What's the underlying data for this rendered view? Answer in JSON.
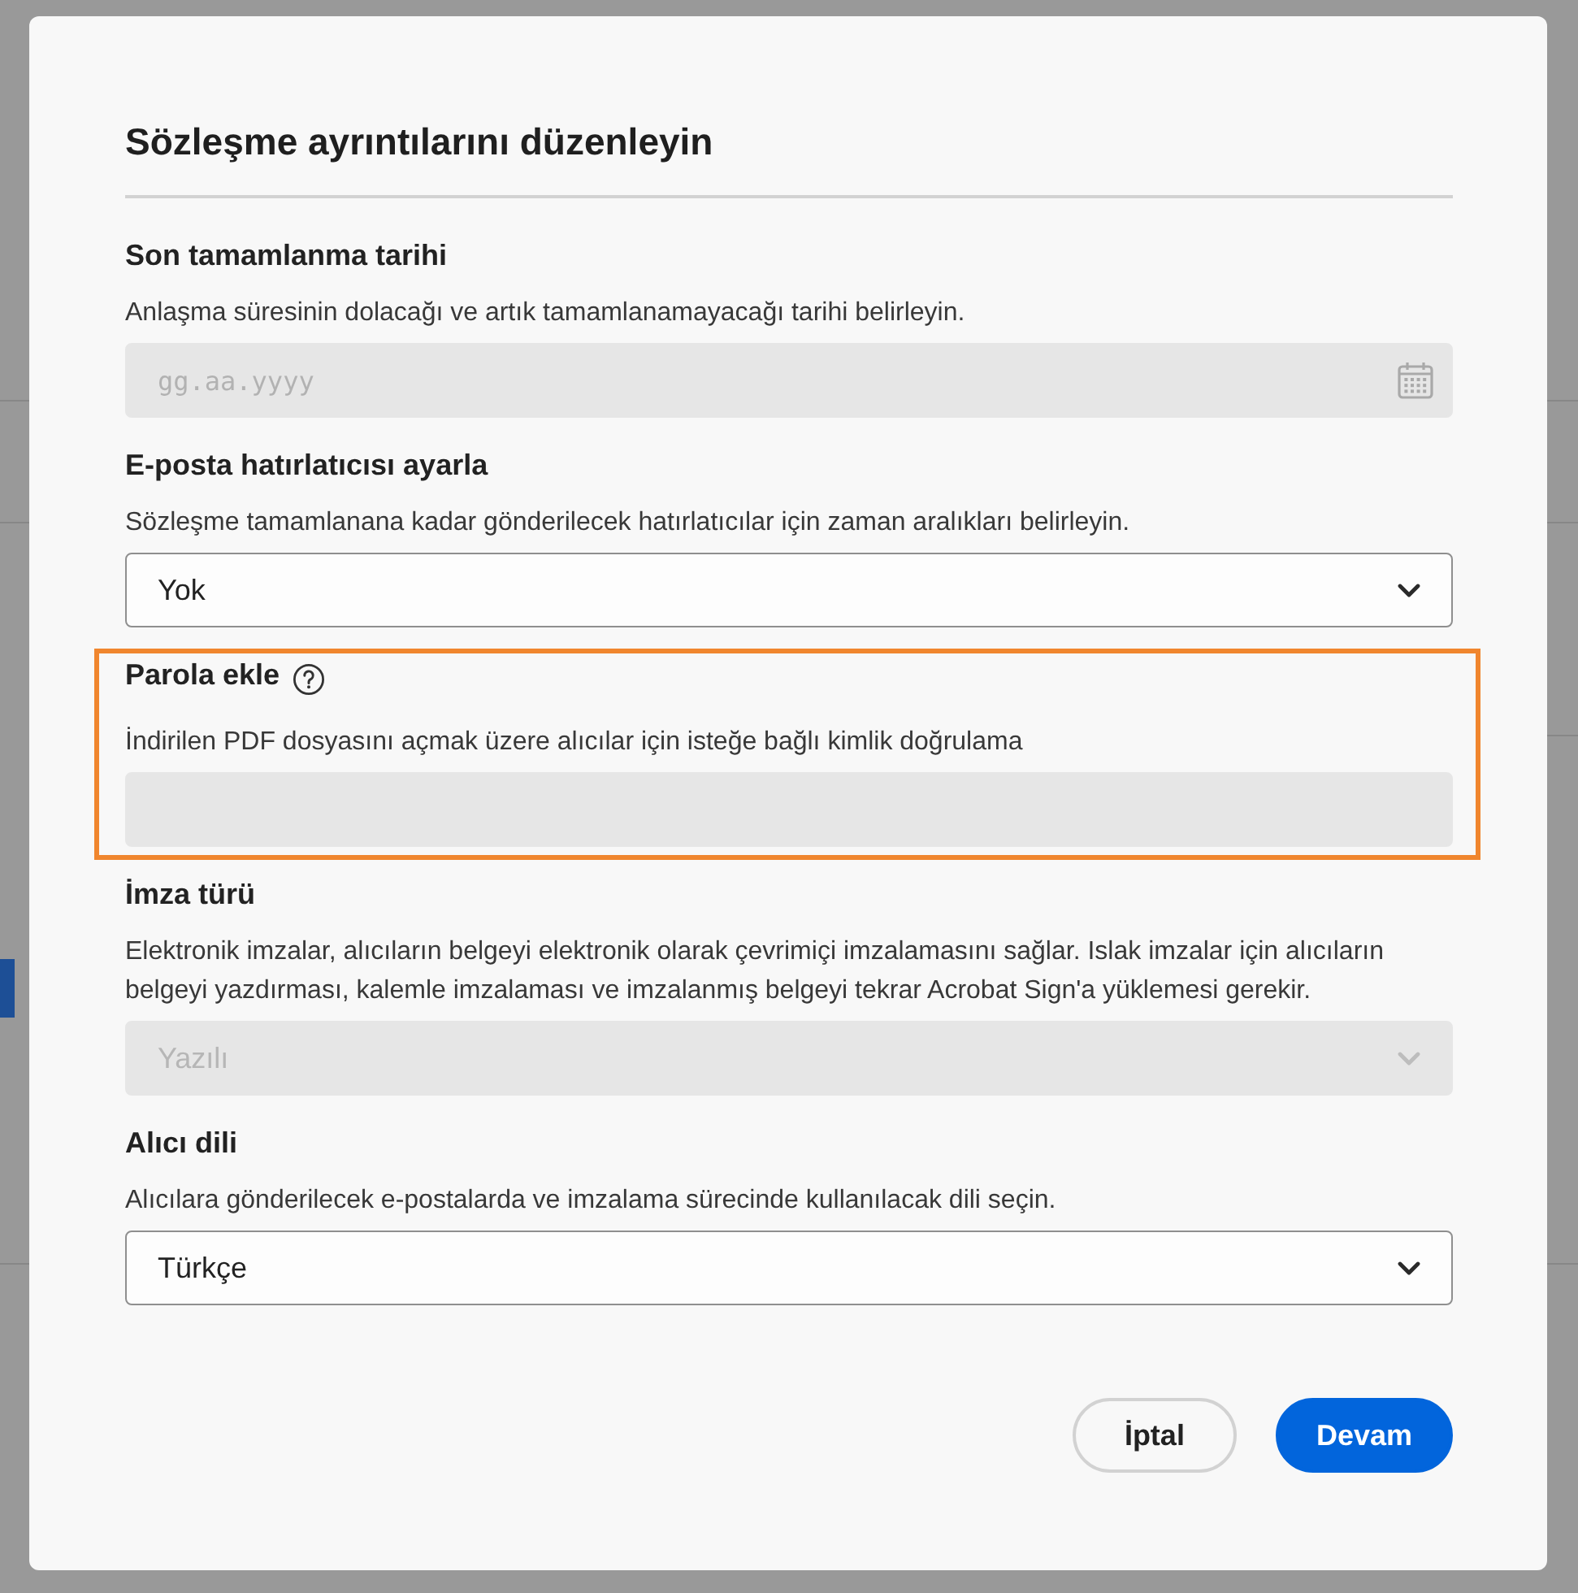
{
  "dialog": {
    "title": "Sözleşme ayrıntılarını düzenleyin"
  },
  "sections": [
    {
      "kind": "date",
      "label": "Son tamamlanma tarihi",
      "help": false,
      "description": "Anlaşma süresinin dolacağı ve artık tamamlanamayacağı tarihi belirleyin.",
      "placeholder": "gg.aa.yyyy",
      "disabled": true,
      "highlighted": false
    },
    {
      "kind": "select",
      "label": "E-posta hatırlatıcısı ayarla",
      "help": false,
      "description": "Sözleşme tamamlanana kadar gönderilecek hatırlatıcılar için zaman aralıkları belirleyin.",
      "value": "Yok",
      "disabled": false,
      "highlighted": false
    },
    {
      "kind": "text",
      "label": "Parola ekle",
      "help": true,
      "description": "İndirilen PDF dosyasını açmak üzere alıcılar için isteğe bağlı kimlik doğrulama",
      "disabled": true,
      "highlighted": true
    },
    {
      "kind": "select",
      "label": "İmza türü",
      "help": false,
      "description": "Elektronik imzalar, alıcıların belgeyi elektronik olarak çevrimiçi imzalamasını sağlar. Islak imzalar için alıcıların belgeyi yazdırması, kalemle imzalaması ve imzalanmış belgeyi tekrar Acrobat Sign'a yüklemesi gerekir.",
      "value": "Yazılı",
      "disabled": true,
      "highlighted": false
    },
    {
      "kind": "select",
      "label": "Alıcı dili",
      "help": false,
      "description": "Alıcılara gönderilecek e-postalarda ve imzalama sürecinde kullanılacak dili seçin.",
      "value": "Türkçe",
      "disabled": false,
      "highlighted": false
    }
  ],
  "buttons": [
    {
      "label": "İptal",
      "kind": "secondary"
    },
    {
      "label": "Devam",
      "kind": "primary"
    }
  ]
}
